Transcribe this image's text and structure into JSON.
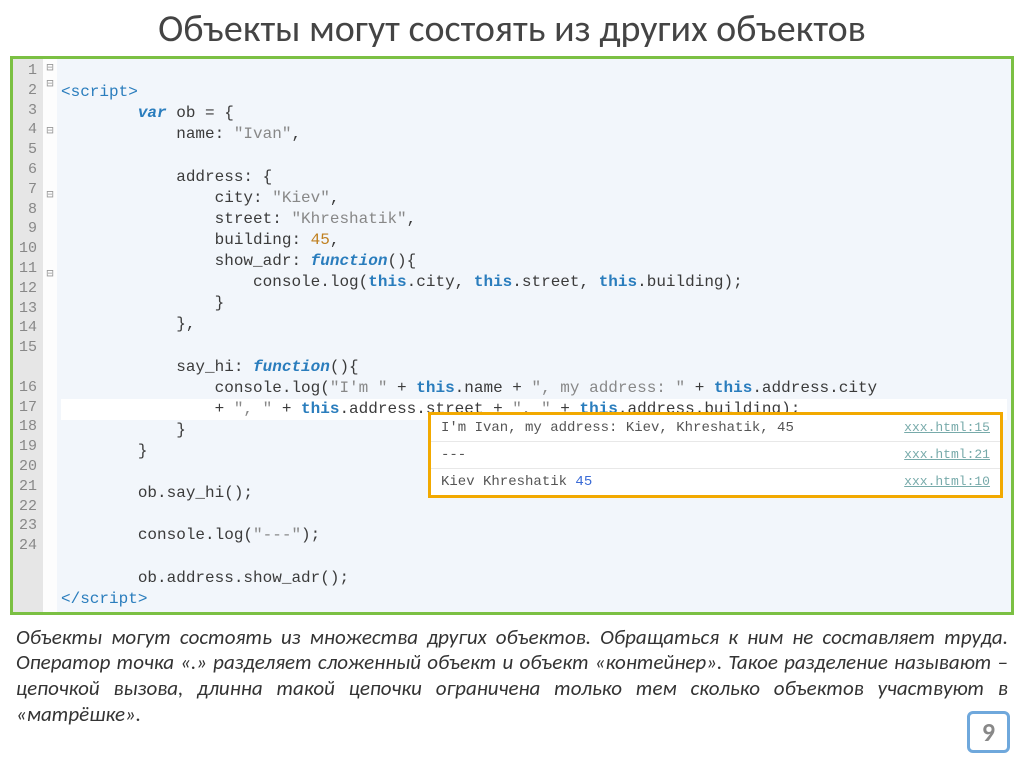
{
  "title": "Объекты могут состоять из других объектов",
  "code": {
    "lines": [
      1,
      2,
      3,
      4,
      5,
      6,
      7,
      8,
      9,
      10,
      11,
      12,
      13,
      14,
      15,
      16,
      17,
      18,
      19,
      20,
      21,
      22,
      23,
      24
    ]
  },
  "console": {
    "rows": [
      {
        "text": "I'm Ivan, my address: Kiev, Khreshatik, 45",
        "src": "xxx.html:15"
      },
      {
        "text": "---",
        "src": "xxx.html:21"
      },
      {
        "text_pre": "Kiev Khreshatik ",
        "num": "45",
        "src": "xxx.html:10"
      }
    ]
  },
  "paragraph": "Объекты могут состоять из множества других объектов. Обращаться к ним не составляет труда. Оператор точка «.» разделяет сложенный объект и объект «контейнер». Такое разделение называют – цепочкой вызова, длинна такой цепочки ограничена только тем сколько объектов участвуют в «матрёшке».",
  "page": "9",
  "src": {
    "l1": "<script>",
    "l2_var": "var",
    "l2_rest": " ob = {",
    "l3_key": "            name: ",
    "l3_val": "\"Ivan\"",
    "l3_end": ",",
    "l5": "            address: {",
    "l6_key": "                city: ",
    "l6_val": "\"Kiev\"",
    "l6_end": ",",
    "l7_key": "                street: ",
    "l7_val": "\"Khreshatik\"",
    "l7_end": ",",
    "l8_key": "                building: ",
    "l8_val": "45",
    "l8_end": ",",
    "l9_key": "                show_adr: ",
    "l9_fn": "function",
    "l9_end": "(){",
    "l10_a": "                    console.log(",
    "l10_b": "this",
    "l10_c": ".city, ",
    "l10_d": "this",
    "l10_e": ".street, ",
    "l10_f": "this",
    "l10_g": ".building);",
    "l11": "                }",
    "l12": "            },",
    "l14_key": "            say_hi: ",
    "l14_fn": "function",
    "l14_end": "(){",
    "l15_a": "                console.log(",
    "l15_s1": "\"I'm \"",
    "l15_b": " + ",
    "l15_c": "this",
    "l15_d": ".name + ",
    "l15_s2": "\", my address: \"",
    "l15_e": " + ",
    "l15_f": "this",
    "l15_g": ".address.city",
    "l15x_a": "                + ",
    "l15x_s1": "\", \"",
    "l15x_b": " + ",
    "l15x_c": "this",
    "l15x_d": ".address.street + ",
    "l15x_s2": "\", \"",
    "l15x_e": " + ",
    "l15x_f": "this",
    "l15x_g": ".address.building);",
    "l16": "            }",
    "l17": "        }",
    "l19": "        ob.say_hi();",
    "l21_a": "        console.log(",
    "l21_s": "\"---\"",
    "l21_b": ");",
    "l23": "        ob.address.show_adr();",
    "l24": "</script>"
  }
}
